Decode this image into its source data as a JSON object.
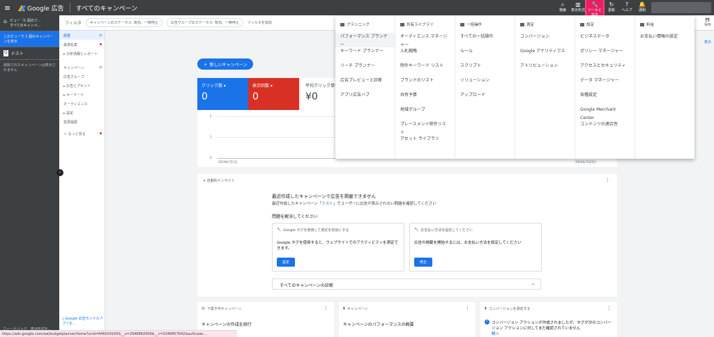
{
  "topbar": {
    "brand": "Google 広告",
    "page_title": "すべてのキャンペーン",
    "tools": [
      {
        "icon": "search-icon",
        "label": "検索"
      },
      {
        "icon": "report-icon",
        "label": "表示形式"
      },
      {
        "icon": "wrench-icon",
        "label": "ツールと設定"
      },
      {
        "icon": "refresh-icon",
        "label": "更新"
      },
      {
        "icon": "help-icon",
        "label": "ヘルプ"
      },
      {
        "icon": "bell-icon",
        "label": "通知"
      }
    ]
  },
  "nav1": {
    "view_label": "ビュー（1 個のフ...",
    "view_sub": "すべてのキャンペ...",
    "selected": "このビューで 1 個のキャンペーンを表示",
    "test": "テスト",
    "note": "削除されたキャンペーンは表示されません",
    "feedback": "フィードバック　表示形式を..."
  },
  "nav2": {
    "items": [
      "概要",
      "最適化案",
      "分析情報とレポート",
      "キャンペーン",
      "広告グループ",
      "広告とアセット",
      "キーワード",
      "オーディエンス",
      "設定",
      "変更履歴",
      "もっと見る"
    ],
    "app_label": "Google 広告モバイルアプリを..."
  },
  "filterbar": {
    "label": "フィルタ",
    "chip1": "キャンペーンのステータス: 有効、一時停止",
    "chip2": "広告グループのステータス: 有効、一時停止",
    "add": "フィルタを追加"
  },
  "main": {
    "new_campaign": "新しいキャンペーン",
    "metrics": [
      {
        "label": "クリック数",
        "value": "0"
      },
      {
        "label": "表示回数",
        "value": "0"
      },
      {
        "label": "平均クリック単価",
        "value": "¥0"
      }
    ],
    "chart": {
      "y2": "2",
      "y1": "1",
      "y0": "0",
      "date_start": "2024年7月1日",
      "date_end": "2024年7月22日"
    },
    "right_label": "表示",
    "toolbar_right": "保存"
  },
  "insight": {
    "title": "自動的インサイト",
    "h1": "最近作成したキャンペーンで広告を掲載できません",
    "p1_before": "最近作成したキャンペーン「",
    "p1_link": "テスト",
    "p1_after": "」でユーザーに広告が表示されない問題を確認してください",
    "h2": "問題を解決してください",
    "sub1_title": "Google タグを使用して測定を有効にする",
    "sub1_text": "Google タグを使用すると、ウェブサイトでのアクティビティを測定できます。",
    "sub1_btn": "設定",
    "sub2_title": "お支払い方法を設定してください",
    "sub2_text": "広告の掲載を開始するには、お支払い方法を設定してください",
    "sub2_btn": "修正",
    "diag": "すべてのキャンペーンの診断"
  },
  "bottom": {
    "c1_title": "下書き中キャンペーン",
    "c1_head": "キャンペーンの作成を続行",
    "c2_title": "キャンペーン",
    "c2_head": "キャンペーンのパフォーマンスの概要",
    "c3_title": "コンバージョンを測定する",
    "c3_text": "コンバージョン アクションが作成されましたが、タグが次のコンバージョン アクションに対してまだ確認されていません",
    "c3_link": "購入"
  },
  "mega": {
    "cols": [
      {
        "head": "プランニング",
        "items": [
          "パフォーマンス プランナー",
          "キーワード プランナー",
          "リーチ プランナー",
          "広告プレビューと診断",
          "アプリ広告ハブ"
        ]
      },
      {
        "head": "共有ライブラリ",
        "items": [
          "オーディエンス マネージャー",
          "入札戦略",
          "除外キーワード リスト",
          "ブランドのリスト",
          "共有予算",
          "地域グループ",
          "プレースメント除外リスト",
          "アセット ライブラリ"
        ]
      },
      {
        "head": "一括操作",
        "items": [
          "すべての一括操作",
          "ルール",
          "スクリプト",
          "ソリューション",
          "アップロード"
        ]
      },
      {
        "head": "測定",
        "items": [
          "コンバージョン",
          "Google アナリティクス",
          "アトリビューション"
        ]
      },
      {
        "head": "設定",
        "items": [
          "ビジネスデータ",
          "ポリシー マネージャー",
          "アクセスとセキュリティ",
          "データ マネージャー",
          "各種設定",
          "Google Merchant Center",
          "コンテンツの適合性"
        ]
      },
      {
        "head": "料金",
        "items": [
          "お支払い情報の設定"
        ]
      }
    ]
  },
  "statusbar": "https://ads.google.com/aw/budgetplanner/home?ocid=646024165&__u=2948882006&__c=5246857642&authuser..."
}
